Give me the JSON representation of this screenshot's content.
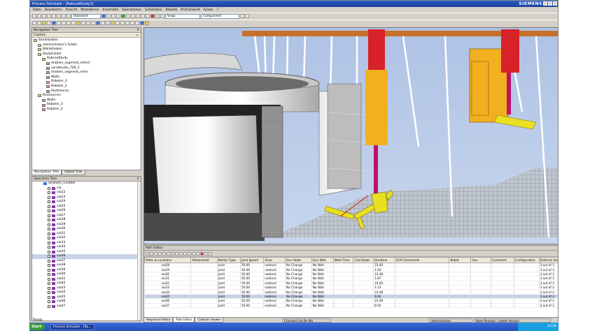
{
  "window": {
    "title": "Process Simulate - [RobcadStudy1]",
    "brand": "SIEMENS"
  },
  "menu": [
    "Datei",
    "Bearbeiten",
    "Ansicht",
    "Modellieren",
    "Kinematik",
    "Operationen",
    "Schweißen",
    "Robotik",
    "Prüfschweiß",
    "Fylnac",
    "?"
  ],
  "toolbar": {
    "standard_combo": "Standard",
    "snap_combo": "Snap",
    "component_combo": "Component"
  },
  "navigation_tree": {
    "header": "Navigation Tree",
    "caption": "Caption",
    "items": [
      {
        "label": "Sandstudien",
        "icon": "folder-icon",
        "indent": 0
      },
      {
        "label": "administrator's Folder",
        "icon": "folder-icon",
        "indent": 1
      },
      {
        "label": "Bibliotheken",
        "icon": "folder-icon",
        "indent": 1
      },
      {
        "label": "StudyFolder",
        "icon": "folder-icon",
        "indent": 1
      },
      {
        "label": "RobcadStudy",
        "icon": "folder-icon",
        "indent": 2
      },
      {
        "label": "drabien_segment_reihe1",
        "icon": "device-icon",
        "indent": 3
      },
      {
        "label": "sandstudio_700_1",
        "icon": "device-icon",
        "indent": 3
      },
      {
        "label": "drabien_segment_reihe",
        "icon": "device-icon",
        "indent": 3
      },
      {
        "label": "Walle",
        "icon": "device-icon",
        "indent": 3
      },
      {
        "label": "Roboter_3",
        "icon": "robot-icon",
        "indent": 3
      },
      {
        "label": "Roboter_2",
        "icon": "robot-icon",
        "indent": 3
      },
      {
        "label": "Stuttmeran",
        "icon": "device-icon",
        "indent": 3
      },
      {
        "label": "Ressourcen",
        "icon": "folder-icon",
        "indent": 1
      },
      {
        "label": "Walle",
        "icon": "device-icon",
        "indent": 2
      },
      {
        "label": "Roboter_3",
        "icon": "robot-icon",
        "indent": 2
      },
      {
        "label": "Roboter_2",
        "icon": "robot-icon",
        "indent": 2
      }
    ],
    "tabs": [
      "Navigation Tree",
      "Object Tree"
    ]
  },
  "operation_tree": {
    "header": "Operation Tree",
    "root": "Strahlen_rundllel",
    "locations": [
      "via",
      "via22",
      "via23",
      "via24",
      "via25",
      "via26",
      "via27",
      "via28",
      "via29",
      "via30",
      "via31",
      "via32",
      "via33",
      "via34",
      "via35",
      "via36",
      "via37",
      "via38",
      "via39",
      "via40",
      "via41",
      "via42",
      "via43",
      "via44",
      "via45",
      "via46",
      "via47"
    ],
    "selected_index": 15
  },
  "path_editor": {
    "header": "Path Editor",
    "columns": [
      "Paths & Locations",
      "Attachment",
      "Motion Type",
      "Joint Speed",
      "Zone",
      "Gun State",
      "Gun Wait",
      "Weld Time",
      "Cool Down",
      "Duration",
      "OLP Commands",
      "Robot",
      "Gun",
      "Comment",
      "Configuration",
      "External Axes"
    ],
    "rows": [
      {
        "loc": "via28",
        "motion": "Joint",
        "speed": "50.00",
        "zone": "nodecel",
        "gun": "No Change",
        "wait": "No Wait",
        "duration": "23.40",
        "ext": "3 out of 3"
      },
      {
        "loc": "via29",
        "motion": "Joint",
        "speed": "50.00",
        "zone": "nodecel",
        "gun": "No Change",
        "wait": "No Wait",
        "duration": "1.04",
        "ext": "3 out of 3"
      },
      {
        "loc": "via30",
        "motion": "Joint",
        "speed": "50.00",
        "zone": "nodecel",
        "gun": "No Change",
        "wait": "No Wait",
        "duration": "23.48",
        "ext": "3 out of 3"
      },
      {
        "loc": "via31",
        "motion": "Joint",
        "speed": "50.00",
        "zone": "nodecel",
        "gun": "No Change",
        "wait": "No Wait",
        "duration": "1.87",
        "ext": "3 out of 3"
      },
      {
        "loc": "via32",
        "motion": "Joint",
        "speed": "50.00",
        "zone": "nodecel",
        "gun": "No Change",
        "wait": "No Wait",
        "duration": "23.40",
        "ext": "3 out of 3"
      },
      {
        "loc": "via33",
        "motion": "Joint",
        "speed": "50.00",
        "zone": "nodecel",
        "gun": "No Change",
        "wait": "No Wait",
        "duration": "1.23",
        "ext": "3 out of 3"
      },
      {
        "loc": "via34",
        "motion": "Joint",
        "speed": "50.00",
        "zone": "nodecel",
        "gun": "No Change",
        "wait": "No Wait",
        "duration": "23.48",
        "ext": "3 out of 3"
      },
      {
        "loc": "via35",
        "motion": "Joint",
        "speed": "50.00",
        "zone": "nodecel",
        "gun": "No Change",
        "wait": "No Wait",
        "duration": "9.92",
        "ext": "3 out of 3"
      },
      {
        "loc": "via36",
        "motion": "Joint",
        "speed": "50.00",
        "zone": "nodecel",
        "gun": "No Change",
        "wait": "No Wait",
        "duration": "23.49",
        "ext": "3 out of 3"
      },
      {
        "loc": "via37",
        "motion": "Joint",
        "speed": "50.00",
        "zone": "nodecel",
        "gun": "No Change",
        "wait": "No Wait",
        "duration": "8.92",
        "ext": "3 out of 3"
      }
    ],
    "selected_index": 7
  },
  "bottom_tabs": [
    "Sequence Editor",
    "Path Editor",
    "Collision Viewer"
  ],
  "status": {
    "ready": "Ready",
    "checked_out": "Checked Out By Me",
    "user": "administrator",
    "version": "Base Release - Latest Version"
  },
  "taskbar": {
    "start": "Start",
    "item": "Process Simulate - [Ro...",
    "clock": "10:56"
  },
  "colors": {
    "titlebar": "#1a3f9a",
    "viewport_bg": "#b6c8e6",
    "robot_red": "#d8222a",
    "robot_yellow": "#f0b020",
    "robot_magenta": "#c0106a",
    "tool_yellow": "#e8e020"
  }
}
